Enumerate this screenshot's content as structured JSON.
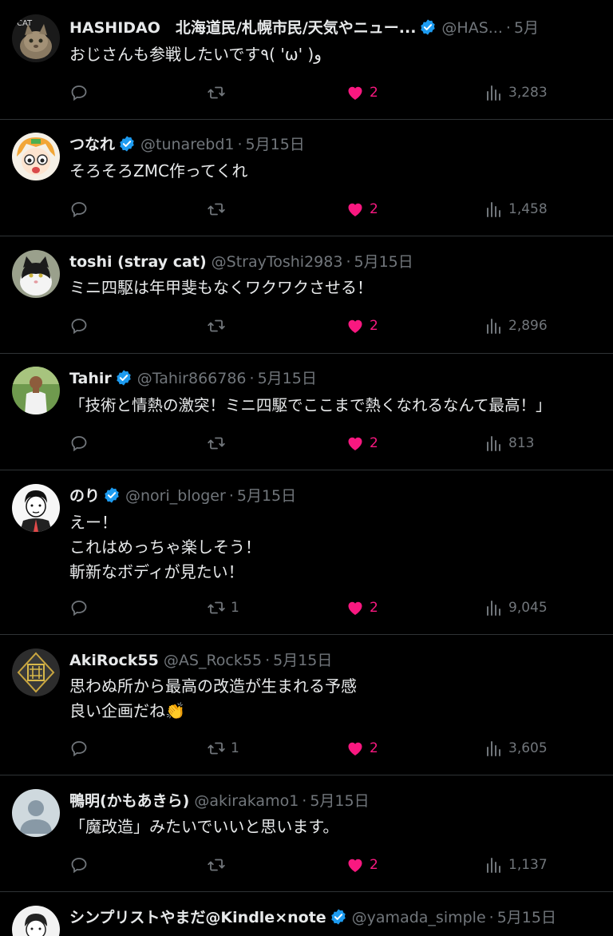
{
  "tweets": [
    {
      "name": "HASHIDAO　北海道民/札幌市民/天気やニュー...",
      "verified": true,
      "handle": "@HAS...",
      "date": "5月",
      "lines": [
        "おじさんも参戦したいです٩( 'ω' )و"
      ],
      "replies": "",
      "retweets": "",
      "likes": "2",
      "views": "3,283",
      "avatar_icon": "cat-photo-avatar"
    },
    {
      "name": "つなれ",
      "verified": true,
      "handle": "@tunarebd1",
      "date": "5月15日",
      "lines": [
        "そろそろZMC作ってくれ"
      ],
      "replies": "",
      "retweets": "",
      "likes": "2",
      "views": "1,458",
      "avatar_icon": "anime-character-avatar"
    },
    {
      "name": "toshi (stray cat)",
      "verified": false,
      "handle": "@StrayToshi2983",
      "date": "5月15日",
      "lines": [
        "ミニ四駆は年甲斐もなくワクワクさせる！"
      ],
      "replies": "",
      "retweets": "",
      "likes": "2",
      "views": "2,896",
      "avatar_icon": "black-white-cat-avatar"
    },
    {
      "name": "Tahir",
      "verified": true,
      "handle": "@Tahir866786",
      "date": "5月15日",
      "lines": [
        "「技術と情熱の激突！ミニ四駆でここまで熱くなれるなんて最高！」"
      ],
      "replies": "",
      "retweets": "",
      "likes": "2",
      "views": "813",
      "avatar_icon": "person-outdoors-avatar"
    },
    {
      "name": "のり",
      "verified": true,
      "handle": "@nori_bloger",
      "date": "5月15日",
      "lines": [
        "えー！",
        "これはめっちゃ楽しそう！",
        "斬新なボディが見たい！"
      ],
      "replies": "",
      "retweets": "1",
      "likes": "2",
      "views": "9,045",
      "avatar_icon": "illustrated-man-avatar"
    },
    {
      "name": "AkiRock55",
      "verified": false,
      "handle": "@AS_Rock55",
      "date": "5月15日",
      "lines": [
        "思わぬ所から最高の改造が生まれる予感",
        "良い企画だね👏"
      ],
      "replies": "",
      "retweets": "1",
      "likes": "2",
      "views": "3,605",
      "avatar_icon": "gold-emblem-avatar"
    },
    {
      "name": "鴨明(かもあきら)",
      "verified": false,
      "handle": "@akirakamo1",
      "date": "5月15日",
      "lines": [
        "「魔改造」みたいでいいと思います。"
      ],
      "replies": "",
      "retweets": "",
      "likes": "2",
      "views": "1,137",
      "avatar_icon": "default-person-avatar"
    },
    {
      "name": "シンプリストやまだ@Kindle×note",
      "verified": true,
      "handle": "@yamada_simple",
      "date": "5月15日",
      "lines": [],
      "replies": "",
      "retweets": "",
      "likes": "",
      "views": "",
      "avatar_icon": "illustrated-person-avatar"
    }
  ],
  "colors": {
    "background": "#000000",
    "text": "#e7e9ea",
    "muted": "#71767b",
    "like": "#f91880",
    "verified": "#1d9bf0",
    "divider": "#2f3336"
  }
}
